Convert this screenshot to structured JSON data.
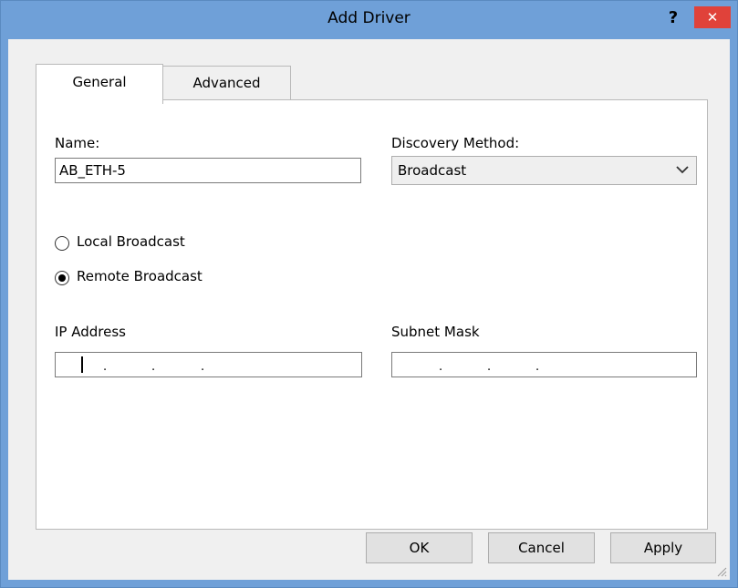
{
  "window": {
    "title": "Add Driver",
    "help_label": "?",
    "close_label": "✕"
  },
  "tabs": [
    {
      "label": "General",
      "selected": true
    },
    {
      "label": "Advanced",
      "selected": false
    }
  ],
  "form": {
    "name_label": "Name:",
    "name_value": "AB_ETH-5",
    "discovery_label": "Discovery Method:",
    "discovery_value": "Broadcast",
    "radio_local": {
      "label": "Local Broadcast",
      "checked": false
    },
    "radio_remote": {
      "label": "Remote Broadcast",
      "checked": true
    },
    "ip_label": "IP Address",
    "subnet_label": "Subnet Mask",
    "ip_separators": [
      ".",
      ".",
      "."
    ],
    "subnet_separators": [
      ".",
      ".",
      "."
    ]
  },
  "buttons": {
    "ok": "OK",
    "cancel": "Cancel",
    "apply": "Apply"
  },
  "colors": {
    "titlebar": "#6fa0d8",
    "close": "#e0423a"
  }
}
